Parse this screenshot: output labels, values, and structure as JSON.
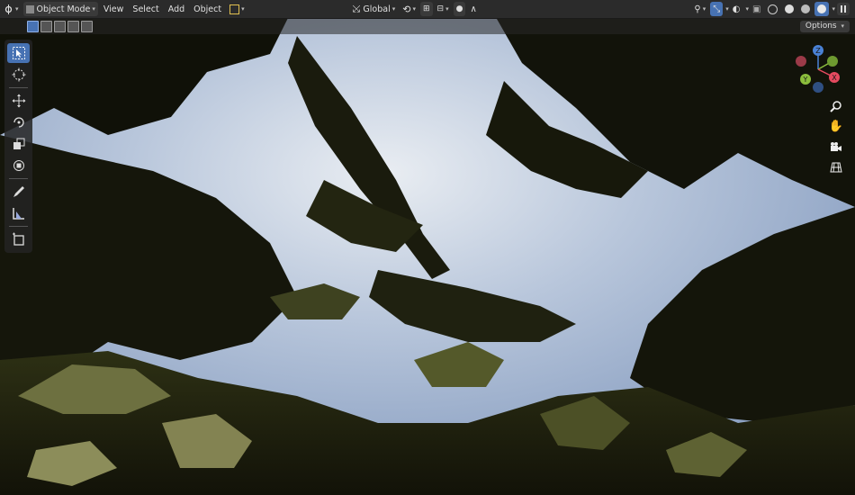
{
  "header": {
    "mode_label": "Object Mode",
    "menus": [
      "View",
      "Select",
      "Add",
      "Object"
    ],
    "orientation_label": "Global"
  },
  "subheader": {
    "options_label": "Options"
  },
  "toolbar": {
    "tools": [
      "select-box-icon",
      "cursor-icon",
      "move-icon",
      "rotate-icon",
      "scale-icon",
      "transform-icon",
      "annotate-icon",
      "measure-icon",
      "add-cube-icon"
    ],
    "active_tool": "select-box-icon"
  },
  "gizmo": {
    "axes": {
      "x_color": "#e54a5f",
      "y_color": "#8bbd3c",
      "z_color": "#4a82d6"
    },
    "labels": {
      "x": "X",
      "y": "Y",
      "z": "Z"
    }
  },
  "navigation": [
    "zoom-icon",
    "pan-hand-icon",
    "camera-view-icon",
    "orthographic-grid-icon"
  ],
  "colors": {
    "accent": "#4772b3",
    "header_bg": "#2b2b2b"
  }
}
